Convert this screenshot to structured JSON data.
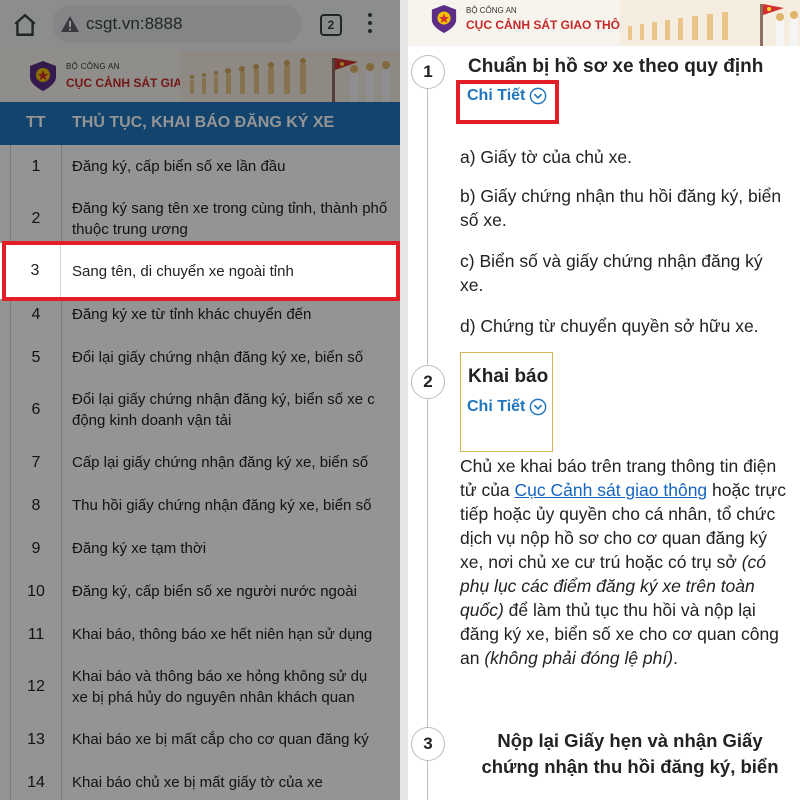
{
  "browser": {
    "url": "csgt.vn:8888",
    "tab_count": "2"
  },
  "site": {
    "ministry": "BỘ CÔNG AN",
    "department": "CỤC CẢNH SÁT GIAO THÔNG"
  },
  "table": {
    "header_col1": "TT",
    "header_col2": "THỦ TỤC, KHAI BÁO ĐĂNG KÝ XE",
    "rows": [
      {
        "num": "1",
        "text": "Đăng ký, cấp biển số xe lần đầu"
      },
      {
        "num": "2",
        "text": "Đăng ký sang tên xe trong cùng tỉnh, thành phố\nthuộc trung ương"
      },
      {
        "num": "3",
        "text": "Sang tên, di chuyển xe ngoài tỉnh"
      },
      {
        "num": "4",
        "text": "Đăng ký xe từ tỉnh khác chuyển đến"
      },
      {
        "num": "5",
        "text": "Đổi lại giấy chứng nhận đăng ký xe, biển số"
      },
      {
        "num": "6",
        "text": "Đổi lại giấy chứng nhận đăng ký, biển số xe c\nđộng kinh doanh vận tải"
      },
      {
        "num": "7",
        "text": "Cấp lại giấy chứng nhận đăng ký xe, biển số"
      },
      {
        "num": "8",
        "text": "Thu hồi giấy chứng nhận đăng ký xe, biển số"
      },
      {
        "num": "9",
        "text": "Đăng ký xe tạm thời"
      },
      {
        "num": "10",
        "text": "Đăng ký, cấp biển số xe người nước ngoài"
      },
      {
        "num": "11",
        "text": "Khai báo, thông báo xe hết niên hạn sử dụng"
      },
      {
        "num": "12",
        "text": "Khai báo và thông báo xe hỏng không sử dụ\nxe bị phá hủy do nguyên nhân khách quan"
      },
      {
        "num": "13",
        "text": "Khai báo xe bị mất cắp cho cơ quan đăng ký"
      },
      {
        "num": "14",
        "text": "Khai báo chủ xe bị mất giấy tờ của xe"
      }
    ]
  },
  "steps": {
    "step1": {
      "number": "1",
      "title": "Chuẩn bị hồ sơ xe theo quy định",
      "link": "Chi Tiết",
      "items": [
        "a) Giấy tờ của chủ xe.",
        "b) Giấy chứng nhận thu hồi đăng ký, biển số xe.",
        "c) Biển số và giấy chứng nhận đăng ký xe.",
        "d) Chứng từ chuyển quyền sở hữu xe."
      ]
    },
    "step2": {
      "number": "2",
      "title": "Khai báo",
      "link": "Chi Tiết",
      "para_part1": "Chủ xe khai báo trên trang thông tin điện tử của ",
      "para_link": "Cục Cảnh sát giao thông",
      "para_part2": " hoặc trực tiếp hoặc ủy quyền cho cá nhân, tổ chức dịch vụ nộp hồ sơ cho cơ quan đăng ký xe, nơi chủ xe cư trú hoặc có trụ sở ",
      "para_italic1": "(có phụ lục các điểm đăng ký xe trên toàn quốc)",
      "para_part3": " để làm thủ tục thu hồi và nộp lại đăng ký xe, biển số xe cho cơ quan công an ",
      "para_italic2": "(không phải đóng lệ phí)",
      "para_end": "."
    },
    "step3": {
      "number": "3",
      "title": "Nộp lại Giấy hẹn và nhận Giấy chứng nhận thu hồi đăng ký, biển"
    }
  },
  "colors": {
    "highlight": "#e21f26",
    "table_header": "#1f76bd",
    "link": "#1f76bd"
  }
}
